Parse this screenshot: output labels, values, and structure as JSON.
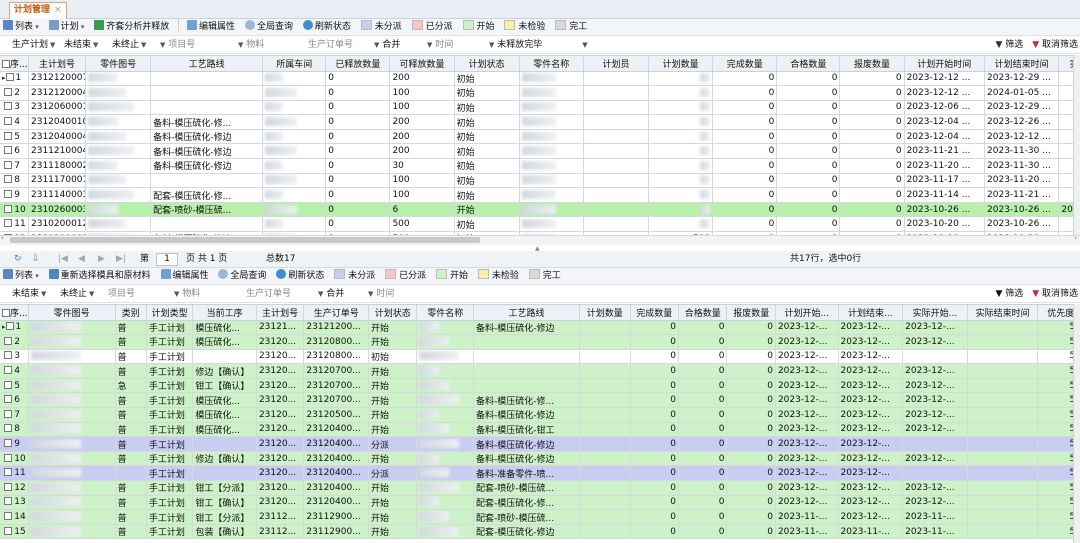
{
  "tab": {
    "title": "计划管理",
    "close": "×"
  },
  "colors": {
    "green": "#cef2c8",
    "blue": "#c9cdf2",
    "unassigned": "#c9cdf2",
    "assigned": "#f4c6c6",
    "started": "#cef2c8",
    "unchecked": "#f7f0a8",
    "done": "#d9d9d9"
  },
  "toolbar1": {
    "list": "列表",
    "plan": "计划",
    "analyze": "齐套分析并释放",
    "edit": "编辑属性",
    "query": "全局查询",
    "refresh": "刷新状态",
    "legend": [
      "未分派",
      "已分派",
      "开始",
      "未检验",
      "完工"
    ]
  },
  "filter1": {
    "plan_type": "生产计划",
    "unfinished": "未结束",
    "unterminated": "未终止",
    "item_no": "项目号",
    "material": "物料",
    "order_no": "生产订单号",
    "merge": "合并",
    "time": "时间",
    "release": "未释放完毕",
    "filter": "筛选",
    "cancel_filter": "取消筛选"
  },
  "grid1": {
    "headers": [
      "序...",
      "主计划号",
      "零件图号",
      "工艺路线",
      "所属车间",
      "已释放数量",
      "可释放数量",
      "计划状态",
      "零件名称",
      "计划员",
      "计划数量",
      "完成数量",
      "合格数量",
      "报废数量",
      "计划开始时间",
      "计划结束时间",
      "实"
    ],
    "rows": [
      {
        "seq": "1",
        "plan": "2312120007",
        "route": "",
        "released": "0",
        "releasable": "200",
        "status": "初始",
        "plan_qty": "",
        "done": "0",
        "ok": "0",
        "scrap": "0",
        "start": "2023-12-12 ...",
        "end": "2023-12-29 ...",
        "extra": ""
      },
      {
        "seq": "2",
        "plan": "2312120004",
        "route": "",
        "released": "0",
        "releasable": "100",
        "status": "初始",
        "plan_qty": "",
        "done": "0",
        "ok": "0",
        "scrap": "0",
        "start": "2023-12-12 ...",
        "end": "2024-01-05 ...",
        "extra": ""
      },
      {
        "seq": "3",
        "plan": "2312060001",
        "route": "",
        "released": "0",
        "releasable": "100",
        "status": "初始",
        "plan_qty": "",
        "done": "0",
        "ok": "0",
        "scrap": "0",
        "start": "2023-12-06 ...",
        "end": "2023-12-29 ...",
        "extra": ""
      },
      {
        "seq": "4",
        "plan": "2312040010",
        "route": "备料-模压硫化-修...",
        "released": "0",
        "releasable": "200",
        "status": "初始",
        "plan_qty": "",
        "done": "0",
        "ok": "0",
        "scrap": "0",
        "start": "2023-12-04 ...",
        "end": "2023-12-26 ...",
        "extra": ""
      },
      {
        "seq": "5",
        "plan": "2312040004",
        "route": "备料-模压硫化-修边",
        "released": "0",
        "releasable": "200",
        "status": "初始",
        "plan_qty": "",
        "done": "0",
        "ok": "0",
        "scrap": "0",
        "start": "2023-12-04 ...",
        "end": "2023-12-12 ...",
        "extra": ""
      },
      {
        "seq": "6",
        "plan": "2311210004",
        "route": "备料-模压硫化-修边",
        "released": "0",
        "releasable": "200",
        "status": "初始",
        "plan_qty": "",
        "done": "0",
        "ok": "0",
        "scrap": "0",
        "start": "2023-11-21 ...",
        "end": "2023-11-30 ...",
        "extra": ""
      },
      {
        "seq": "7",
        "plan": "2311180002",
        "route": "备料-模压硫化-修边",
        "released": "0",
        "releasable": "30",
        "status": "初始",
        "plan_qty": "",
        "done": "0",
        "ok": "0",
        "scrap": "0",
        "start": "2023-11-20 ...",
        "end": "2023-11-30 ...",
        "extra": ""
      },
      {
        "seq": "8",
        "plan": "2311170001",
        "route": "",
        "released": "0",
        "releasable": "100",
        "status": "初始",
        "plan_qty": "",
        "done": "0",
        "ok": "0",
        "scrap": "0",
        "start": "2023-11-17 ...",
        "end": "2023-11-20 ...",
        "extra": ""
      },
      {
        "seq": "9",
        "plan": "2311140003",
        "route": "配套-模压硫化-修...",
        "released": "0",
        "releasable": "100",
        "status": "初始",
        "plan_qty": "",
        "done": "0",
        "ok": "0",
        "scrap": "0",
        "start": "2023-11-14 ...",
        "end": "2023-11-21 ...",
        "extra": ""
      },
      {
        "seq": "10",
        "plan": "2310260003",
        "route": "配套-喷砂-模压硫...",
        "released": "0",
        "releasable": "6",
        "status": "开始",
        "plan_qty": "",
        "done": "0",
        "ok": "0",
        "scrap": "0",
        "start": "2023-10-26 ...",
        "end": "2023-10-26 ...",
        "extra": "2023-"
      },
      {
        "seq": "11",
        "plan": "2310200012",
        "route": "",
        "released": "0",
        "releasable": "500",
        "status": "初始",
        "plan_qty": "",
        "done": "0",
        "ok": "0",
        "scrap": "0",
        "start": "2023-10-20 ...",
        "end": "2023-10-26 ...",
        "extra": ""
      },
      {
        "seq": "12",
        "plan": "2310100003",
        "route": "备料-模压硫化-修边",
        "released": "0",
        "releasable": "500",
        "status": "初始",
        "plan_qty": "500",
        "done": "0",
        "ok": "0",
        "scrap": "0",
        "start": "2023-10-10 ...",
        "end": "2023-10-20 ...",
        "extra": ""
      }
    ]
  },
  "pager": {
    "page_label": "第",
    "page": "1",
    "page_of": "页 共 1 页",
    "total": "总数17",
    "summary": "共17行，选中0行"
  },
  "toolbar2": {
    "list": "列表",
    "reselect": "重新选择模具和原材料",
    "edit": "编辑属性",
    "query": "全局查询",
    "refresh": "刷新状态",
    "legend": [
      "未分派",
      "已分派",
      "开始",
      "未检验",
      "完工"
    ]
  },
  "filter2": {
    "unfinished": "未结束",
    "unterminated": "未终止",
    "item_no": "项目号",
    "material": "物料",
    "order_no": "生产订单号",
    "merge": "合并",
    "time": "时间",
    "filter": "筛选",
    "cancel_filter": "取消筛选"
  },
  "grid2": {
    "headers": [
      "序...",
      "零件图号",
      "类别",
      "计划类型",
      "当前工序",
      "主计划号",
      "生产订单号",
      "计划状态",
      "零件名称",
      "工艺路线",
      "计划数量",
      "完成数量",
      "合格数量",
      "报废数量",
      "计划开始...",
      "计划结束...",
      "实际开始...",
      "实际结束时间",
      "优先度"
    ],
    "rows": [
      {
        "seq": "1",
        "cat": "普",
        "ptype": "手工计划",
        "op": "模压硫化...",
        "main": "23121...",
        "order": "23121200...",
        "status": "开始",
        "route": "备料-模压硫化-修边",
        "done": "0",
        "ok": "0",
        "scrap": "0",
        "ps": "2023-12-...",
        "pe": "2023-12-...",
        "as": "2023-12-...",
        "ae": "",
        "pri": "50",
        "style": "green"
      },
      {
        "seq": "2",
        "cat": "普",
        "ptype": "手工计划",
        "op": "模压硫化...",
        "main": "23120...",
        "order": "23120800...",
        "status": "开始",
        "route": "",
        "done": "0",
        "ok": "0",
        "scrap": "0",
        "ps": "2023-12-...",
        "pe": "2023-12-...",
        "as": "2023-12-...",
        "ae": "",
        "pri": "50",
        "style": "green"
      },
      {
        "seq": "3",
        "cat": "普",
        "ptype": "手工计划",
        "op": "",
        "main": "23120...",
        "order": "23120800...",
        "status": "初始",
        "route": "",
        "done": "0",
        "ok": "0",
        "scrap": "0",
        "ps": "2023-12-...",
        "pe": "2023-12-...",
        "as": "",
        "ae": "",
        "pri": "50",
        "style": "white"
      },
      {
        "seq": "4",
        "cat": "普",
        "ptype": "手工计划",
        "op": "修边【确认】",
        "main": "23120...",
        "order": "23120700...",
        "status": "开始",
        "route": "",
        "done": "0",
        "ok": "0",
        "scrap": "0",
        "ps": "2023-12-...",
        "pe": "2023-12-...",
        "as": "2023-12-...",
        "ae": "",
        "pri": "50",
        "style": "green"
      },
      {
        "seq": "5",
        "cat": "急",
        "ptype": "手工计划",
        "op": "钳工【确认】",
        "main": "23120...",
        "order": "23120700...",
        "status": "开始",
        "route": "",
        "done": "0",
        "ok": "0",
        "scrap": "0",
        "ps": "2023-12-...",
        "pe": "2023-12-...",
        "as": "2023-12-...",
        "ae": "",
        "pri": "50",
        "style": "green"
      },
      {
        "seq": "6",
        "cat": "普",
        "ptype": "手工计划",
        "op": "模压硫化...",
        "main": "23120...",
        "order": "23120700...",
        "status": "开始",
        "route": "备料-模压硫化-修...",
        "done": "0",
        "ok": "0",
        "scrap": "0",
        "ps": "2023-12-...",
        "pe": "2023-12-...",
        "as": "2023-12-...",
        "ae": "",
        "pri": "50",
        "style": "green"
      },
      {
        "seq": "7",
        "cat": "普",
        "ptype": "手工计划",
        "op": "模压硫化...",
        "main": "23120...",
        "order": "23120500...",
        "status": "开始",
        "route": "备料-模压硫化-修边",
        "done": "0",
        "ok": "0",
        "scrap": "0",
        "ps": "2023-12-...",
        "pe": "2023-12-...",
        "as": "2023-12-...",
        "ae": "",
        "pri": "50",
        "style": "green"
      },
      {
        "seq": "8",
        "cat": "普",
        "ptype": "手工计划",
        "op": "模压硫化...",
        "main": "23120...",
        "order": "23120400...",
        "status": "开始",
        "route": "备料-模压硫化-钳工",
        "done": "0",
        "ok": "0",
        "scrap": "0",
        "ps": "2023-12-...",
        "pe": "2023-12-...",
        "as": "2023-12-...",
        "ae": "",
        "pri": "50",
        "style": "green"
      },
      {
        "seq": "9",
        "cat": "普",
        "ptype": "手工计划",
        "op": "",
        "main": "23120...",
        "order": "23120400...",
        "status": "分派",
        "route": "备料-模压硫化-修边",
        "done": "0",
        "ok": "0",
        "scrap": "0",
        "ps": "2023-12-...",
        "pe": "2023-12-...",
        "as": "",
        "ae": "",
        "pri": "50",
        "style": "blue"
      },
      {
        "seq": "10",
        "cat": "普",
        "ptype": "手工计划",
        "op": "修边【确认】",
        "main": "23120...",
        "order": "23120400...",
        "status": "开始",
        "route": "备料-模压硫化-修边",
        "done": "0",
        "ok": "0",
        "scrap": "0",
        "ps": "2023-12-...",
        "pe": "2023-12-...",
        "as": "2023-12-...",
        "ae": "",
        "pri": "50",
        "style": "green"
      },
      {
        "seq": "11",
        "cat": "",
        "ptype": "手工计划",
        "op": "",
        "main": "23120...",
        "order": "23120400...",
        "status": "分派",
        "route": "备料-准备零件-喷...",
        "done": "0",
        "ok": "0",
        "scrap": "0",
        "ps": "2023-12-...",
        "pe": "2023-12-...",
        "as": "",
        "ae": "",
        "pri": "50",
        "style": "blue"
      },
      {
        "seq": "12",
        "cat": "普",
        "ptype": "手工计划",
        "op": "钳工【分派】",
        "main": "23120...",
        "order": "23120400...",
        "status": "开始",
        "route": "配套-喷砂-模压硫...",
        "done": "0",
        "ok": "0",
        "scrap": "0",
        "ps": "2023-12-...",
        "pe": "2023-12-...",
        "as": "2023-12-...",
        "ae": "",
        "pri": "50",
        "style": "green"
      },
      {
        "seq": "13",
        "cat": "普",
        "ptype": "手工计划",
        "op": "钳工【确认】",
        "main": "23120...",
        "order": "23120400...",
        "status": "开始",
        "route": "配套-模压硫化-修...",
        "done": "0",
        "ok": "0",
        "scrap": "0",
        "ps": "2023-12-...",
        "pe": "2023-12-...",
        "as": "2023-12-...",
        "ae": "",
        "pri": "50",
        "style": "green"
      },
      {
        "seq": "14",
        "cat": "普",
        "ptype": "手工计划",
        "op": "钳工【分派】",
        "main": "23112...",
        "order": "23112900...",
        "status": "开始",
        "route": "配套-喷砂-模压硫...",
        "done": "0",
        "ok": "0",
        "scrap": "0",
        "ps": "2023-11-...",
        "pe": "2023-12-...",
        "as": "2023-11-...",
        "ae": "",
        "pri": "50",
        "style": "green"
      },
      {
        "seq": "15",
        "cat": "普",
        "ptype": "手工计划",
        "op": "包装【确认】",
        "main": "23112...",
        "order": "23112900...",
        "status": "开始",
        "route": "配套-模压硫化-修边",
        "done": "0",
        "ok": "0",
        "scrap": "0",
        "ps": "2023-11-...",
        "pe": "2023-11-...",
        "as": "2023-11-...",
        "ae": "",
        "pri": "50",
        "style": "green"
      }
    ]
  }
}
